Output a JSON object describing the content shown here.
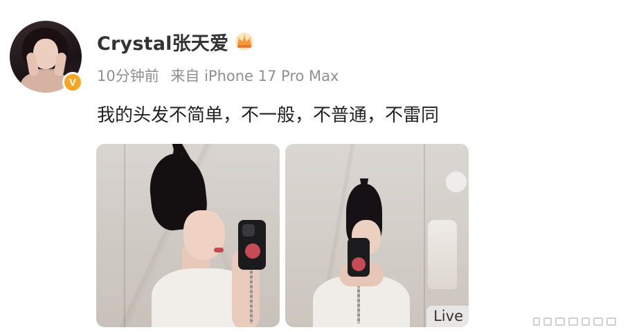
{
  "post": {
    "author": {
      "name": "Crystal张天爱",
      "verified_badge": "V",
      "avatar_icon": "avatar-photo",
      "crown_icon": "crown-icon"
    },
    "meta": {
      "time": "10分钟前",
      "source": "来自 iPhone 17 Pro Max"
    },
    "text": "我的头发不简单，不一般，不普通，不雷同",
    "photos": [
      {
        "id": "photo-1",
        "live": false
      },
      {
        "id": "photo-2",
        "live": true,
        "badge": "Live"
      }
    ]
  },
  "colors": {
    "username": "#333333",
    "meta": "#8f8f8f",
    "text": "#222222",
    "verified": "#f5a623"
  }
}
